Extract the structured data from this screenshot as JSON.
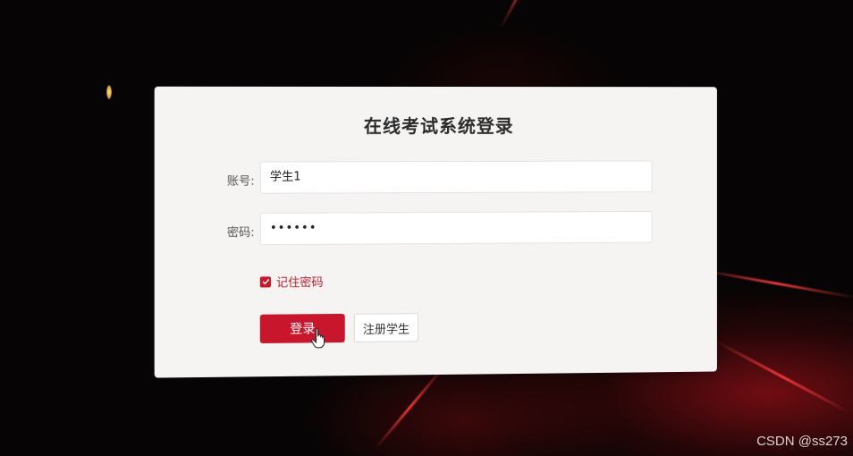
{
  "login": {
    "title": "在线考试系统登录",
    "account_label": "账号:",
    "account_value": "学生1",
    "password_label": "密码:",
    "password_value": "••••••",
    "remember_label": "记住密码",
    "remember_checked": true,
    "login_button": "登录",
    "register_button": "注册学生"
  },
  "watermark": "CSDN @ss273",
  "colors": {
    "accent": "#c8162c",
    "card_bg": "#f6f4f3"
  }
}
